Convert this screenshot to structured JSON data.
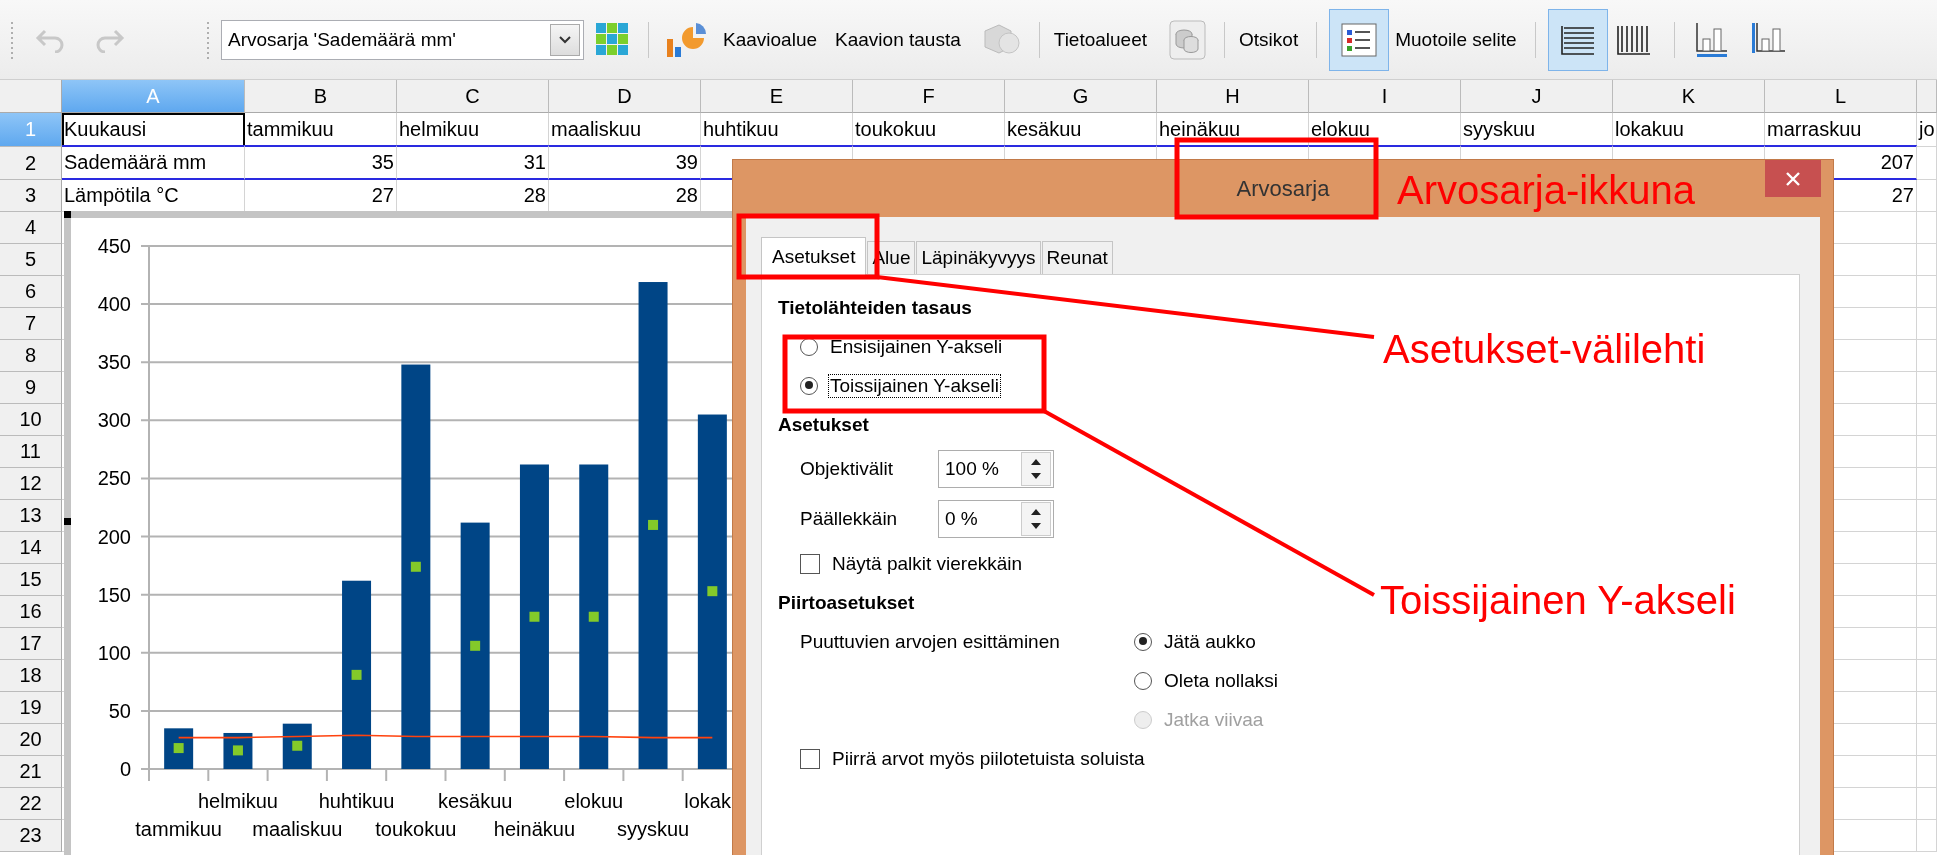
{
  "toolbar": {
    "undo": {
      "disabled": true
    },
    "redo": {
      "disabled": true
    },
    "series_select": "Arvosarja 'Sademäärä mm'",
    "buttons": [
      {
        "label": "Kaavioalue"
      },
      {
        "label": "Kaavion tausta"
      },
      {
        "label": "Tietoalueet"
      },
      {
        "label": "Otsikot"
      },
      {
        "label": "Muotoile selite"
      }
    ],
    "legend_toggle": {
      "selected": true
    },
    "horizontal_grid": {
      "selected": true
    },
    "vertical_grid": {
      "selected": false
    }
  },
  "sheet": {
    "columns": [
      {
        "label": "A",
        "selected": true
      },
      {
        "label": "B",
        "selected": false
      },
      {
        "label": "C",
        "selected": false
      },
      {
        "label": "D",
        "selected": false
      },
      {
        "label": "E",
        "selected": false
      },
      {
        "label": "F",
        "selected": false
      },
      {
        "label": "G",
        "selected": false
      },
      {
        "label": "H",
        "selected": false
      },
      {
        "label": "I",
        "selected": false
      },
      {
        "label": "J",
        "selected": false
      },
      {
        "label": "K",
        "selected": false
      },
      {
        "label": "L",
        "selected": false
      }
    ],
    "rows": [
      {
        "number": "1",
        "selected": true,
        "highlighted": false,
        "kind": "labels",
        "cells": [
          "Kuukausi",
          "tammikuu",
          "helmikuu",
          "maaliskuu",
          "huhtikuu",
          "toukokuu",
          "kesäkuu",
          "heinäkuu",
          "elokuu",
          "syyskuu",
          "lokakuu",
          "marraskuu",
          "jo"
        ]
      },
      {
        "number": "2",
        "selected": false,
        "highlighted": true,
        "kind": "numbers",
        "cells": [
          "Sademäärä mm",
          "35",
          "31",
          "39",
          null,
          null,
          null,
          null,
          null,
          null,
          null,
          "207"
        ]
      },
      {
        "number": "3",
        "selected": false,
        "highlighted": false,
        "kind": "numbers",
        "cells": [
          "Lämpötila °C",
          "27",
          "28",
          "28",
          null,
          null,
          null,
          null,
          null,
          null,
          null,
          "27"
        ]
      }
    ],
    "more_rows": [
      "4",
      "5",
      "6",
      "7",
      "8",
      "9",
      "10",
      "11",
      "12",
      "13",
      "14",
      "15",
      "16",
      "17",
      "18",
      "19",
      "20",
      "21",
      "22",
      "23"
    ]
  },
  "chart": {
    "chart_data": {
      "type": "bar",
      "grid": true,
      "categories": [
        "tammikuu",
        "helmikuu",
        "maaliskuu",
        "huhtikuu",
        "toukokuu",
        "kesäkuu",
        "heinäkuu",
        "elokuu",
        "syyskuu",
        "lokak"
      ],
      "ylim": [
        0,
        450
      ],
      "yticks": [
        0,
        50,
        100,
        150,
        200,
        250,
        300,
        350,
        400,
        450
      ],
      "series": [
        {
          "type": "bar",
          "color": "#004586",
          "values": [
            35,
            31,
            39,
            162,
            348,
            212,
            262,
            262,
            419,
            305
          ]
        },
        {
          "type": "scatter",
          "color": "#83ca2a",
          "values": [
            18,
            16,
            20,
            81,
            174,
            106,
            131,
            131,
            210,
            153
          ]
        },
        {
          "type": "line",
          "color": "#ff420e",
          "values": [
            27,
            27,
            28,
            29,
            28,
            28,
            28,
            28,
            27,
            27
          ]
        }
      ]
    }
  },
  "dialog": {
    "title": "Arvosarja",
    "tabs": [
      {
        "label": "Asetukset",
        "selected": true
      },
      {
        "label": "Alue",
        "selected": false
      },
      {
        "label": "Läpinäkyvyys",
        "selected": false
      },
      {
        "label": "Reunat",
        "selected": false
      }
    ],
    "align": {
      "heading": "Tietolähteiden tasaus",
      "options": [
        {
          "label": "Ensisijainen Y-akseli",
          "selected": false,
          "focused": false
        },
        {
          "label": "Toissijainen Y-akseli",
          "selected": true,
          "focused": true
        }
      ]
    },
    "settings": {
      "heading": "Asetukset",
      "spinners": [
        {
          "label": "Objektivälit",
          "value": "100 %"
        },
        {
          "label": "Päällekkäin",
          "value": "0 %"
        }
      ],
      "side_by_side": {
        "label": "Näytä palkit vierekkäin",
        "checked": false
      }
    },
    "plot": {
      "heading": "Piirtoasetukset",
      "missing_label": "Puuttuvien arvojen esittäminen",
      "missing_options": [
        {
          "label": "Jätä aukko",
          "selected": true,
          "disabled": false
        },
        {
          "label": "Oleta nollaksi",
          "selected": false,
          "disabled": false
        },
        {
          "label": "Jatka viivaa",
          "selected": false,
          "disabled": true
        }
      ],
      "hidden_cells": {
        "label": "Piirrä arvot myös piilotetuista soluista",
        "checked": false
      }
    }
  },
  "annotations": [
    {
      "text": "Arvosarja-ikkuna"
    },
    {
      "text": "Asetukset-välilehti"
    },
    {
      "text": "Toissijainen Y-akseli"
    }
  ]
}
